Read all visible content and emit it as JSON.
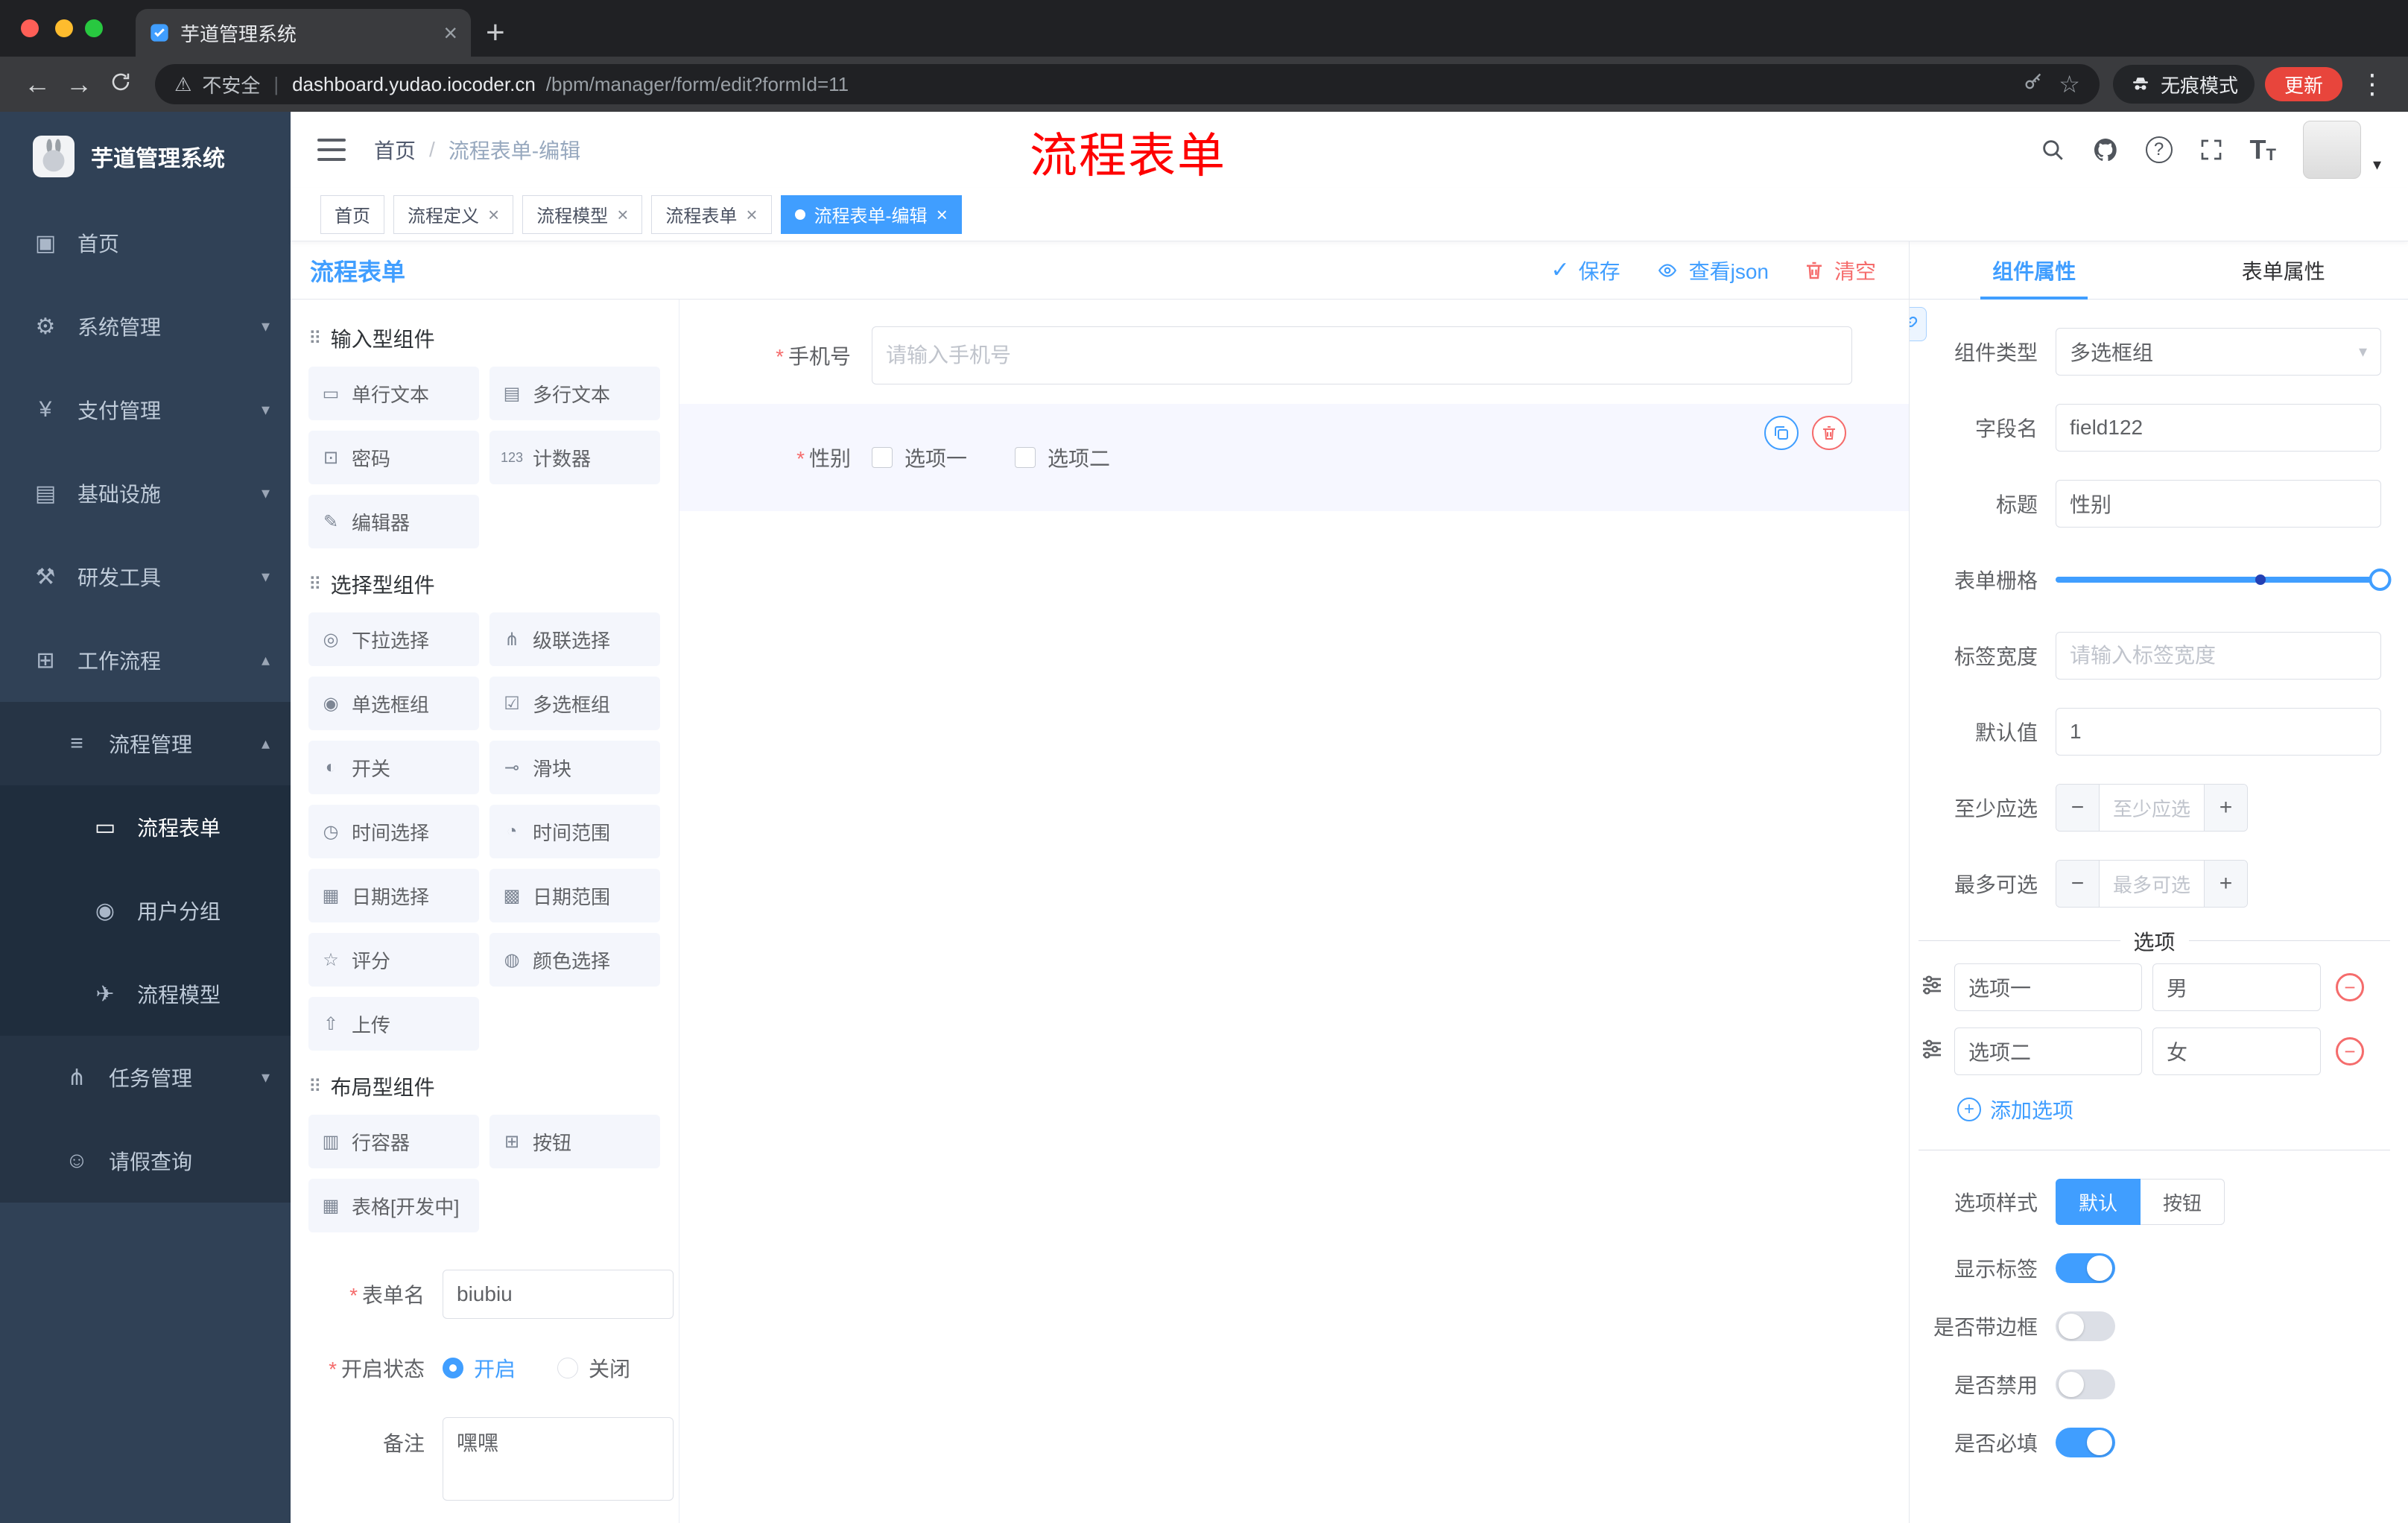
{
  "colors": {
    "accent": "#409EFF",
    "danger": "#F56C6C",
    "sidebar_bg": "#304156",
    "annotation_red": "#FE0000",
    "active_tag_bg": "#409EFF",
    "update_button_bg": "#E8453C",
    "selected_row_bg": "#F6F7FF"
  },
  "glyphs": {
    "close": "×",
    "plus": "+",
    "minus": "−",
    "kebab": "⋮",
    "star": "☆",
    "warning": "⚠",
    "check": "✓",
    "slash": "/",
    "back": "←",
    "forward": "→",
    "caret_down": "▾",
    "pipe": "|",
    "question": "?",
    "required": "*"
  },
  "browser": {
    "tab_title": "芋道管理系统",
    "security_label": "不安全",
    "url_host": "dashboard.yudao.iocoder.cn",
    "url_path": "/bpm/manager/form/edit?formId=11",
    "incognito_label": "无痕模式",
    "update_label": "更新"
  },
  "sidebar": {
    "logo_title": "芋道管理系统",
    "items": [
      {
        "label": "首页",
        "glyph": "▣",
        "caret": ""
      },
      {
        "label": "系统管理",
        "glyph": "⚙",
        "caret": "▾"
      },
      {
        "label": "支付管理",
        "glyph": "¥",
        "caret": "▾"
      },
      {
        "label": "基础设施",
        "glyph": "▤",
        "caret": "▾"
      },
      {
        "label": "研发工具",
        "glyph": "⚒",
        "caret": "▾"
      },
      {
        "label": "工作流程",
        "glyph": "⊞",
        "caret": "▴"
      },
      {
        "label": "流程管理",
        "glyph": "≡",
        "caret": "▴"
      },
      {
        "label": "流程表单",
        "glyph": "▭",
        "caret": ""
      },
      {
        "label": "用户分组",
        "glyph": "◉",
        "caret": ""
      },
      {
        "label": "流程模型",
        "glyph": "✈",
        "caret": ""
      },
      {
        "label": "任务管理",
        "glyph": "⋔",
        "caret": "▾"
      },
      {
        "label": "请假查询",
        "glyph": "☺",
        "caret": ""
      }
    ]
  },
  "header": {
    "breadcrumb_home": "首页",
    "breadcrumb_current": "流程表单-编辑",
    "annotation": "流程表单"
  },
  "tags": [
    {
      "label": "首页",
      "closable": false,
      "active": false
    },
    {
      "label": "流程定义",
      "closable": true,
      "active": false
    },
    {
      "label": "流程模型",
      "closable": true,
      "active": false
    },
    {
      "label": "流程表单",
      "closable": true,
      "active": false
    },
    {
      "label": "流程表单-编辑",
      "closable": true,
      "active": true
    }
  ],
  "designer": {
    "title": "流程表单",
    "actions": {
      "save": "保存",
      "view_json": "查看json",
      "clear": "清空"
    },
    "groups": [
      {
        "title": "输入型组件",
        "items": [
          {
            "label": "单行文本",
            "glyph": "▭"
          },
          {
            "label": "多行文本",
            "glyph": "▤"
          },
          {
            "label": "密码",
            "glyph": "⊡"
          },
          {
            "label": "计数器",
            "glyph": "123"
          },
          {
            "label": "编辑器",
            "glyph": "✎"
          }
        ]
      },
      {
        "title": "选择型组件",
        "items": [
          {
            "label": "下拉选择",
            "glyph": "◎"
          },
          {
            "label": "级联选择",
            "glyph": "⋔"
          },
          {
            "label": "单选框组",
            "glyph": "◉"
          },
          {
            "label": "多选框组",
            "glyph": "☑"
          },
          {
            "label": "开关",
            "glyph": "◐"
          },
          {
            "label": "滑块",
            "glyph": "⊸"
          },
          {
            "label": "时间选择",
            "glyph": "◷"
          },
          {
            "label": "时间范围",
            "glyph": "◔"
          },
          {
            "label": "日期选择",
            "glyph": "▦"
          },
          {
            "label": "日期范围",
            "glyph": "▩"
          },
          {
            "label": "评分",
            "glyph": "☆"
          },
          {
            "label": "颜色选择",
            "glyph": "◍"
          },
          {
            "label": "上传",
            "glyph": "⇧"
          }
        ]
      },
      {
        "title": "布局型组件",
        "items": [
          {
            "label": "行容器",
            "glyph": "▥"
          },
          {
            "label": "按钮",
            "glyph": "⊞"
          },
          {
            "label": "表格[开发中]",
            "glyph": "▦"
          }
        ]
      }
    ],
    "meta": {
      "name_label": "表单名",
      "name_value": "biubiu",
      "status_label": "开启状态",
      "status_on": "开启",
      "status_off": "关闭",
      "status_selected": "开启",
      "remark_label": "备注",
      "remark_value": "嘿嘿"
    },
    "canvas": {
      "phone_label": "手机号",
      "phone_placeholder": "请输入手机号",
      "gender_label": "性别",
      "gender_options": [
        "选项一",
        "选项二"
      ]
    }
  },
  "props": {
    "tab_component": "组件属性",
    "tab_form": "表单属性",
    "active_tab": "组件属性",
    "rows": {
      "component_type_label": "组件类型",
      "component_type_value": "多选框组",
      "field_name_label": "字段名",
      "field_name_value": "field122",
      "title_label": "标题",
      "title_value": "性别",
      "grid_label": "表单栅格",
      "label_width_label": "标签宽度",
      "label_width_placeholder": "请输入标签宽度",
      "default_label": "默认值",
      "default_value": "1",
      "min_label": "至少应选",
      "min_placeholder": "至少应选",
      "max_label": "最多可选",
      "max_placeholder": "最多可选"
    },
    "options": {
      "divider": "选项",
      "rows": [
        {
          "label": "选项一",
          "value": "男"
        },
        {
          "label": "选项二",
          "value": "女"
        }
      ],
      "add": "添加选项"
    },
    "style": {
      "label": "选项样式",
      "selected": "默认",
      "other": "按钮"
    },
    "switches": [
      {
        "label": "显示标签",
        "on": true
      },
      {
        "label": "是否带边框",
        "on": false
      },
      {
        "label": "是否禁用",
        "on": false
      },
      {
        "label": "是否必填",
        "on": true
      }
    ]
  }
}
